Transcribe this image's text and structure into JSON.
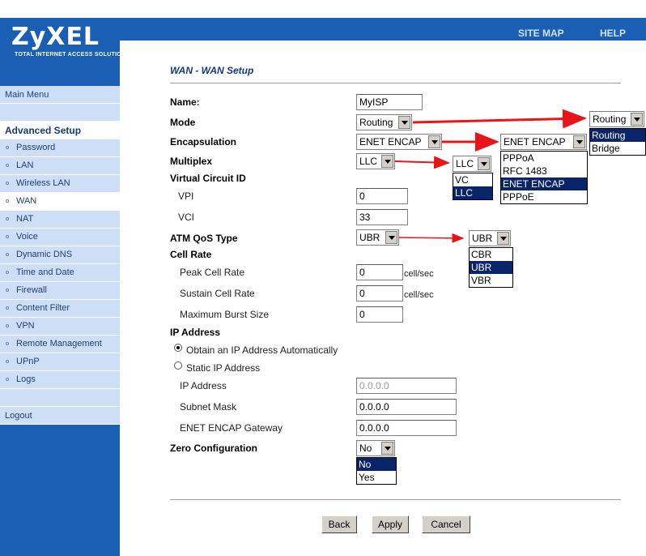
{
  "brand": {
    "logo": "ZyXEL",
    "tagline": "TOTAL INTERNET ACCESS SOLUTION"
  },
  "topnav": {
    "site_map": "SITE MAP",
    "help": "HELP"
  },
  "sidebar": {
    "main_menu": "Main Menu",
    "section": "Advanced Setup",
    "items": [
      "Password",
      "LAN",
      "Wireless LAN",
      "WAN",
      "NAT",
      "Voice",
      "Dynamic DNS",
      "Time and Date",
      "Firewall",
      "Content Filter",
      "VPN",
      "Remote Management",
      "UPnP",
      "Logs"
    ],
    "logout": "Logout"
  },
  "page": {
    "title": "WAN - WAN Setup"
  },
  "form": {
    "name_label": "Name:",
    "name_value": "MyISP",
    "mode_label": "Mode",
    "mode_value": "Routing",
    "encap_label": "Encapsulation",
    "encap_value": "ENET ENCAP",
    "multiplex_label": "Multiplex",
    "multiplex_value": "LLC",
    "vc_id_label": "Virtual Circuit ID",
    "vpi_label": "VPI",
    "vpi_value": "0",
    "vci_label": "VCI",
    "vci_value": "33",
    "atm_label": "ATM QoS Type",
    "atm_value": "UBR",
    "cell_rate_label": "Cell Rate",
    "pcr_label": "Peak Cell Rate",
    "pcr_value": "0",
    "pcr_unit": "cell/sec",
    "scr_label": "Sustain Cell Rate",
    "scr_value": "0",
    "scr_unit": "cell/sec",
    "mbs_label": "Maximum Burst Size",
    "mbs_value": "0",
    "ip_label": "IP Address",
    "auto_ip_label": "Obtain an IP Address Automatically",
    "static_ip_label": "Static IP Address",
    "ip_addr_label": "IP Address",
    "ip_addr_value": "0.0.0.0",
    "subnet_label": "Subnet Mask",
    "subnet_value": "0.0.0.0",
    "gateway_label": "ENET ENCAP Gateway",
    "gateway_value": "0.0.0.0",
    "zero_conf_label": "Zero Configuration",
    "zero_conf_value": "No"
  },
  "dropdowns": {
    "mode": {
      "value": "Routing",
      "options": [
        "Routing",
        "Bridge"
      ]
    },
    "encap": {
      "value": "ENET ENCAP",
      "options": [
        "PPPoA",
        "RFC 1483",
        "ENET ENCAP",
        "PPPoE"
      ]
    },
    "multiplex": {
      "value": "LLC",
      "options": [
        "VC",
        "LLC"
      ]
    },
    "atm": {
      "value": "UBR",
      "options": [
        "CBR",
        "UBR",
        "VBR"
      ]
    },
    "zero_conf": {
      "options": [
        "No",
        "Yes"
      ]
    }
  },
  "buttons": {
    "back": "Back",
    "apply": "Apply",
    "cancel": "Cancel"
  },
  "colors": {
    "brand_blue": "#1a5fb4",
    "sidebar_item": "#cfdef7",
    "arrow_red": "#e8141a",
    "highlight": "#0a246a"
  }
}
